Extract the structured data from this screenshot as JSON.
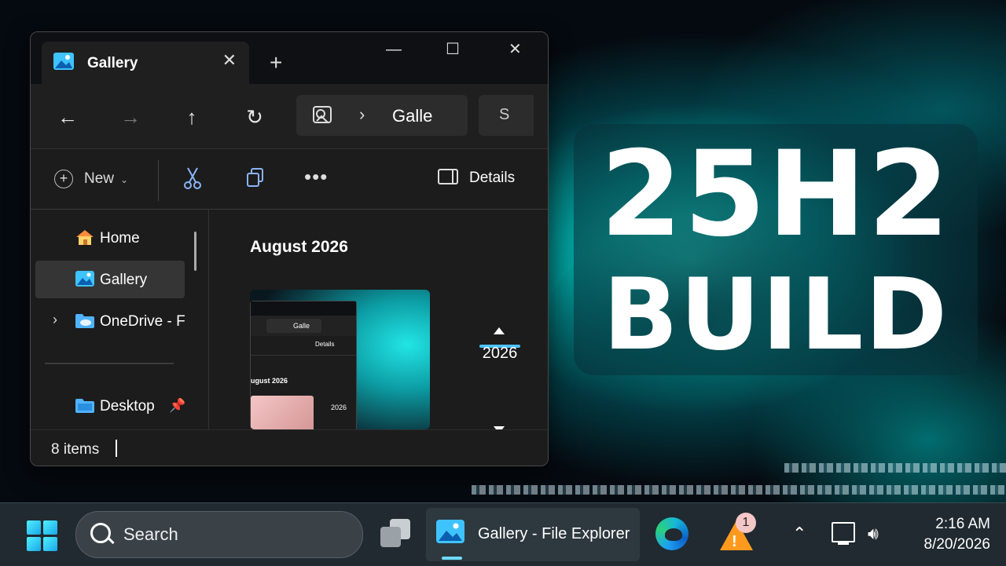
{
  "window": {
    "tab_title": "Gallery",
    "tab_close": "✕",
    "new_tab": "+",
    "minimize": "—",
    "maximize": "☐",
    "close": "✕"
  },
  "nav": {
    "back": "←",
    "forward": "→",
    "up": "↑",
    "refresh": "↻",
    "address_separator": "›",
    "address_text": "Galle",
    "search_partial": "S"
  },
  "commandbar": {
    "new_label": "New",
    "details_label": "Details"
  },
  "sidebar": {
    "items": [
      {
        "label": "Home"
      },
      {
        "label": "Gallery"
      },
      {
        "label": "OneDrive - F"
      },
      {
        "label": "Desktop"
      }
    ]
  },
  "content": {
    "month": "August 2026",
    "timeline_year": "2026",
    "thumbnail": {
      "address": "Galle",
      "details": "Details",
      "month": "ugust 2026",
      "year": "2026"
    }
  },
  "status": {
    "items": "8 items"
  },
  "title_card": {
    "line1": "25H2",
    "line2": "BUILD"
  },
  "taskbar": {
    "search_label": "Search",
    "app_label": "Gallery - File Explorer",
    "badge_count": "1",
    "time": "2:16 AM",
    "date": "8/20/2026"
  },
  "colors": {
    "accent": "#4cc2ff",
    "glow": "#22e5e5",
    "warning": "#ff9a1f"
  }
}
